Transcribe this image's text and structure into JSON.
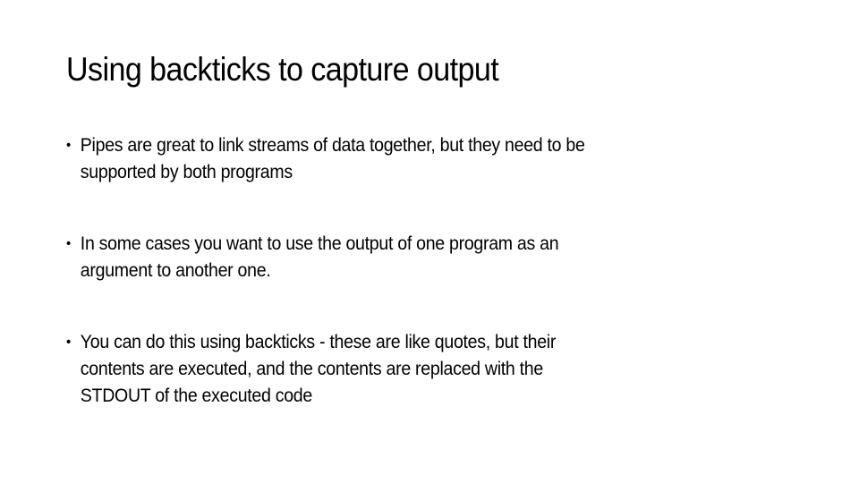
{
  "slide": {
    "title": "Using backticks to capture output",
    "bullet_glyph": "•",
    "bullets": [
      {
        "lines": [
          "Pipes are great to link streams of data together, but they need to be",
          "supported by both programs"
        ]
      },
      {
        "lines": [
          "In some cases you want to use the output of one program as an",
          "argument to another one."
        ]
      },
      {
        "lines": [
          "You can do this using backticks - these are like quotes, but their",
          "contents are executed, and the contents are replaced with the",
          "STDOUT of the executed code"
        ]
      }
    ]
  }
}
